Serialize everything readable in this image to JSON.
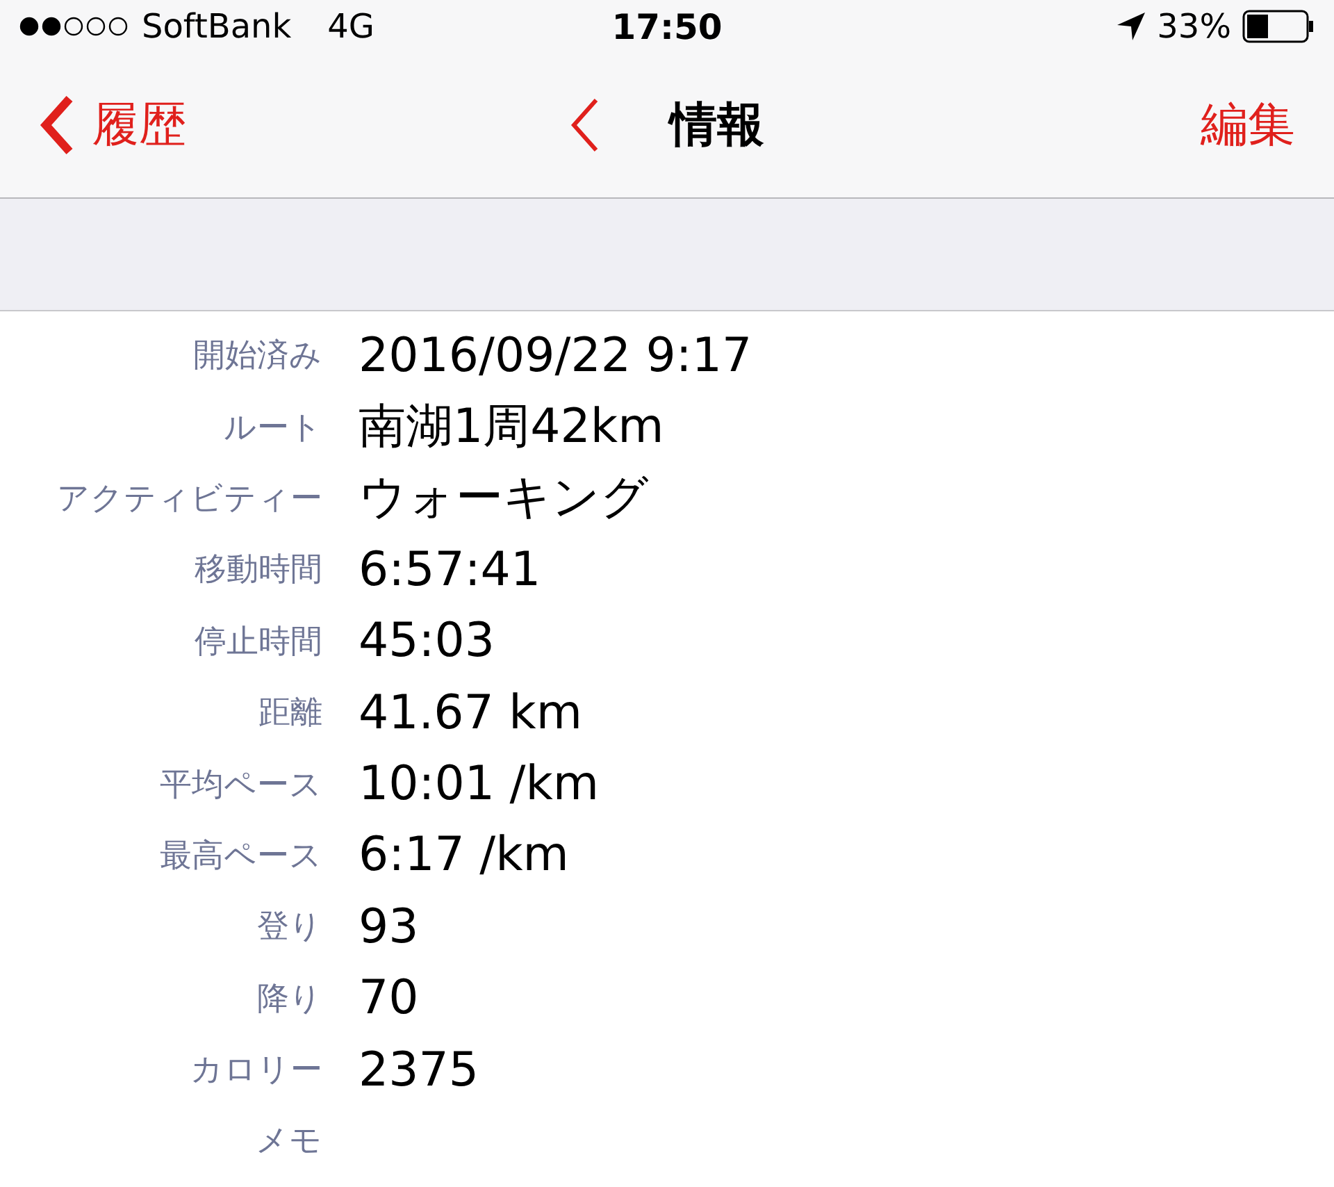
{
  "status_bar": {
    "carrier": "SoftBank",
    "network": "4G",
    "time": "17:50",
    "battery": "33%"
  },
  "nav": {
    "back": "履歴",
    "title": "情報",
    "edit": "編集"
  },
  "rows": [
    {
      "label": "開始済み",
      "value": "2016/09/22 9:17"
    },
    {
      "label": "ルート",
      "value": "南湖1周42km"
    },
    {
      "label": "アクティビティー",
      "value": "ウォーキング"
    },
    {
      "label": "移動時間",
      "value": "6:57:41"
    },
    {
      "label": "停止時間",
      "value": "45:03"
    },
    {
      "label": "距離",
      "value": "41.67 km"
    },
    {
      "label": "平均ペース",
      "value": "10:01 /km"
    },
    {
      "label": "最高ペース",
      "value": "6:17 /km"
    },
    {
      "label": "登り",
      "value": "93"
    },
    {
      "label": "降り",
      "value": "70"
    },
    {
      "label": "カロリー",
      "value": "2375"
    },
    {
      "label": "メモ"
    }
  ]
}
